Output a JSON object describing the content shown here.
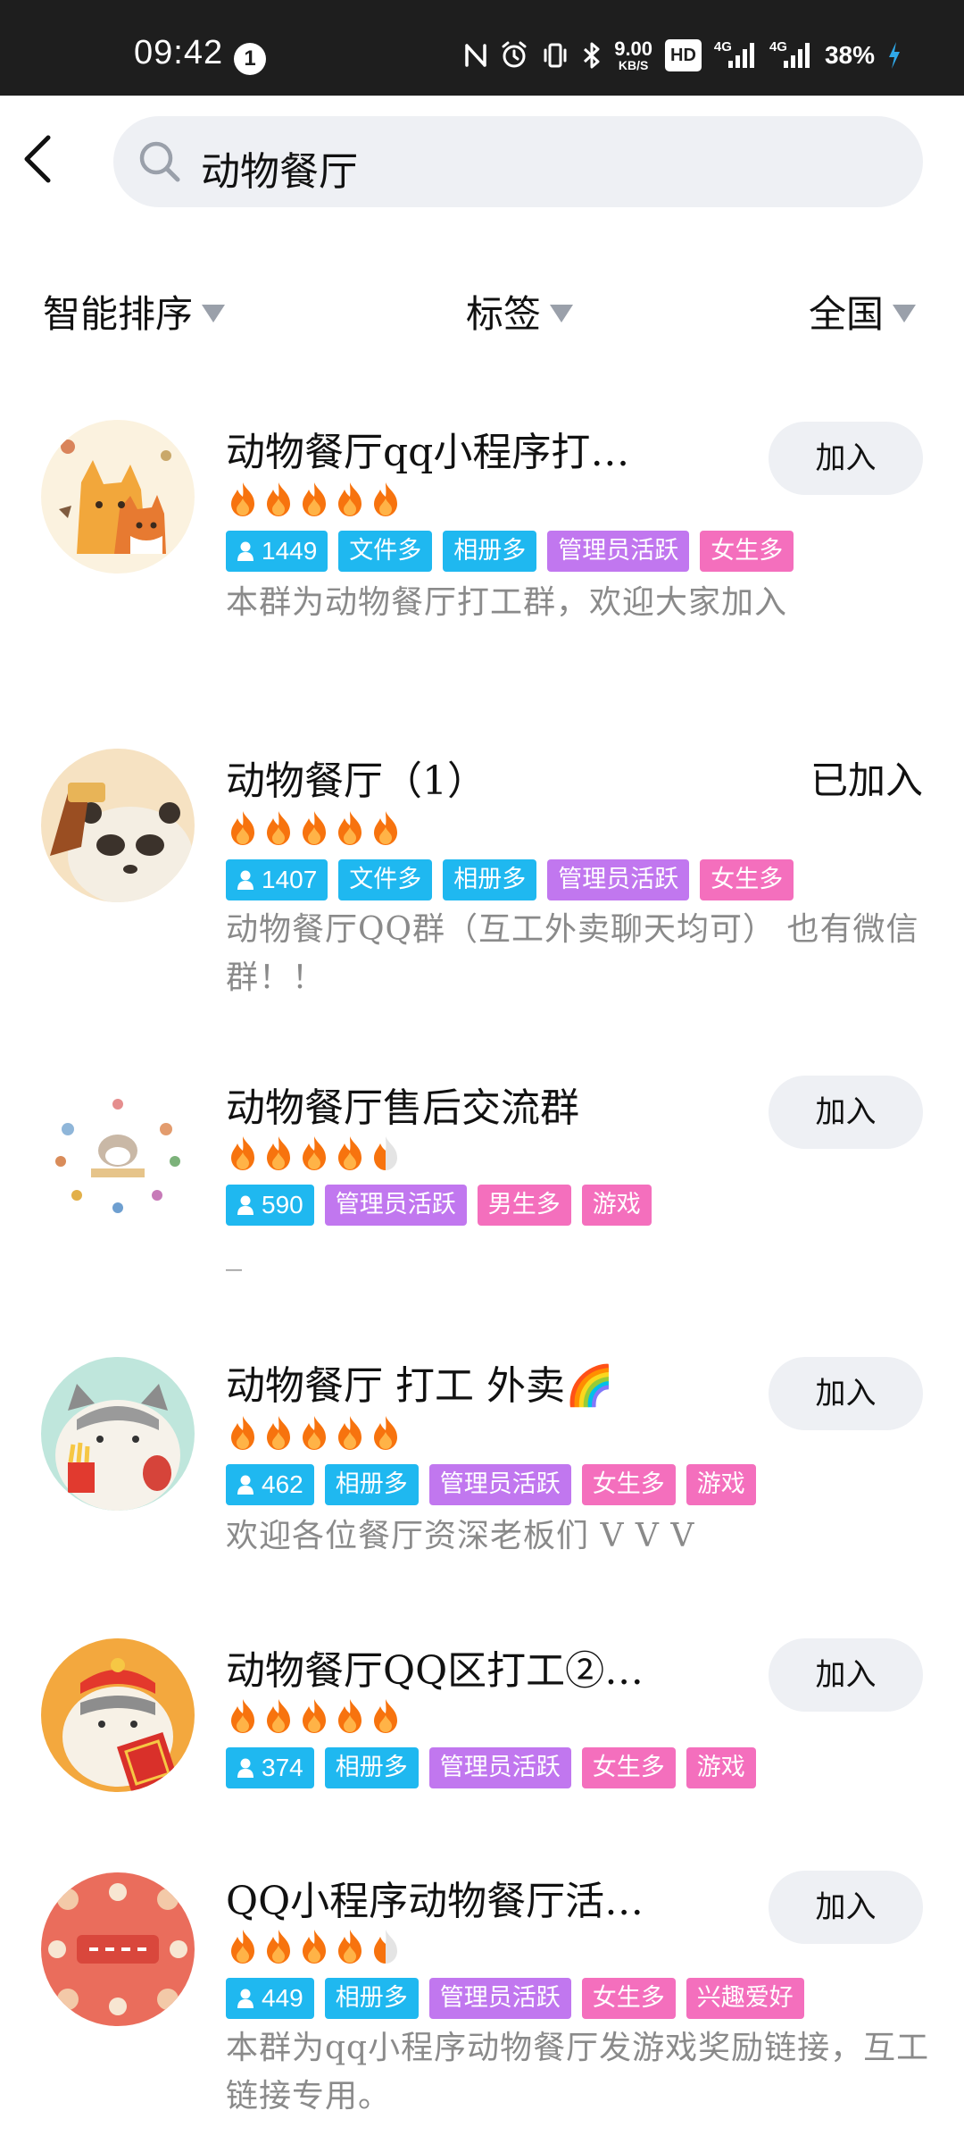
{
  "status_bar": {
    "time": "09:42",
    "notification_count": "1",
    "net_speed_value": "9.00",
    "net_speed_unit": "KB/S",
    "hd_label": "HD",
    "sim1_label": "4G",
    "sim2_label": "4G",
    "battery_percent": "38%"
  },
  "search": {
    "query": "动物餐厅"
  },
  "filters": {
    "sort_label": "智能排序",
    "tag_label": "标签",
    "region_label": "全国"
  },
  "groups": [
    {
      "name": "动物餐厅qq小程序打…",
      "fire_level": 5,
      "members": "1449",
      "tags": [
        {
          "label": "文件多",
          "color": "blue"
        },
        {
          "label": "相册多",
          "color": "blue"
        },
        {
          "label": "管理员活跃",
          "color": "purple"
        },
        {
          "label": "女生多",
          "color": "pink"
        }
      ],
      "description": "本群为动物餐厅打工群，欢迎大家加入",
      "action": "加入"
    },
    {
      "name": "动物餐厅（1）",
      "fire_level": 5,
      "members": "1407",
      "tags": [
        {
          "label": "文件多",
          "color": "blue"
        },
        {
          "label": "相册多",
          "color": "blue"
        },
        {
          "label": "管理员活跃",
          "color": "purple"
        },
        {
          "label": "女生多",
          "color": "pink"
        }
      ],
      "description": "动物餐厅QQ群（互工外卖聊天均可） 也有微信群！！",
      "action": "已加入"
    },
    {
      "name": "动物餐厅售后交流群",
      "fire_level": 4.5,
      "members": "590",
      "tags": [
        {
          "label": "管理员活跃",
          "color": "purple"
        },
        {
          "label": "男生多",
          "color": "pink"
        },
        {
          "label": "游戏",
          "color": "pink"
        }
      ],
      "description": "_",
      "action": "加入"
    },
    {
      "name": "动物餐厅 打工 外卖🌈",
      "fire_level": 5,
      "members": "462",
      "tags": [
        {
          "label": "相册多",
          "color": "blue"
        },
        {
          "label": "管理员活跃",
          "color": "purple"
        },
        {
          "label": "女生多",
          "color": "pink"
        },
        {
          "label": "游戏",
          "color": "pink"
        }
      ],
      "description": "欢迎各位餐厅资深老板们 V V V",
      "action": "加入"
    },
    {
      "name": "动物餐厅QQ区打工②…",
      "fire_level": 5,
      "members": "374",
      "tags": [
        {
          "label": "相册多",
          "color": "blue"
        },
        {
          "label": "管理员活跃",
          "color": "purple"
        },
        {
          "label": "女生多",
          "color": "pink"
        },
        {
          "label": "游戏",
          "color": "pink"
        }
      ],
      "description": "",
      "action": "加入"
    },
    {
      "name": "QQ小程序动物餐厅活…",
      "fire_level": 4.5,
      "members": "449",
      "tags": [
        {
          "label": "相册多",
          "color": "blue"
        },
        {
          "label": "管理员活跃",
          "color": "purple"
        },
        {
          "label": "女生多",
          "color": "pink"
        },
        {
          "label": "兴趣爱好",
          "color": "pink"
        }
      ],
      "description": "本群为qq小程序动物餐厅发游戏奖励链接，互工链接专用。",
      "action": "加入"
    }
  ],
  "colors": {
    "tag_blue": "#1fb8f0",
    "tag_purple": "#c177ef",
    "tag_pink": "#f46fbd",
    "fire": "#f7730e"
  }
}
